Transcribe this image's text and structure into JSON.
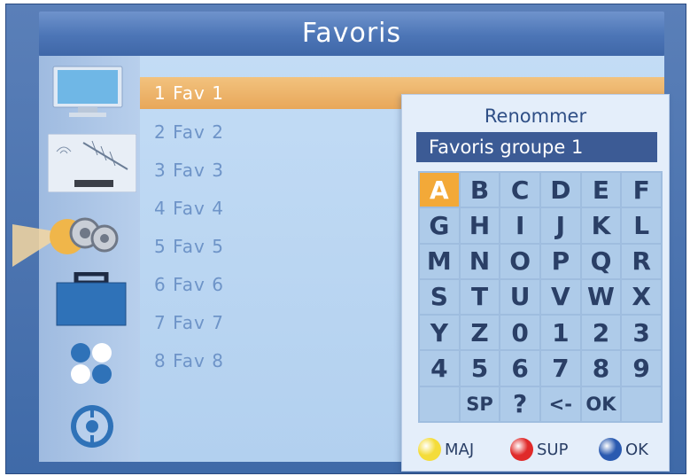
{
  "header": {
    "title": "Favoris"
  },
  "menu_icons": [
    "tv-icon",
    "antenna-icon",
    "gear-icon",
    "briefcase-icon",
    "dots-icon",
    "film-reel-icon"
  ],
  "favorites": [
    {
      "label": "1 Fav 1",
      "selected": true
    },
    {
      "label": "2 Fav 2"
    },
    {
      "label": "3 Fav 3"
    },
    {
      "label": "4 Fav 4"
    },
    {
      "label": "5 Fav 5"
    },
    {
      "label": "6 Fav 6"
    },
    {
      "label": "7 Fav 7"
    },
    {
      "label": "8 Fav 8"
    }
  ],
  "rename_dialog": {
    "title": "Renommer",
    "input_value": "Favoris groupe 1",
    "keys": [
      "A",
      "B",
      "C",
      "D",
      "E",
      "F",
      "G",
      "H",
      "I",
      "J",
      "K",
      "L",
      "M",
      "N",
      "O",
      "P",
      "Q",
      "R",
      "S",
      "T",
      "U",
      "V",
      "W",
      "X",
      "Y",
      "Z",
      "0",
      "1",
      "2",
      "3",
      "4",
      "5",
      "6",
      "7",
      "8",
      "9",
      "",
      "SP",
      "?",
      "<-",
      "OK",
      ""
    ],
    "active_key": "A",
    "legend": [
      {
        "color": "#f4dc3a",
        "label": "MAJ"
      },
      {
        "color": "#e02a2a",
        "label": "SUP"
      },
      {
        "color": "#2a5ab0",
        "label": "OK"
      }
    ]
  }
}
